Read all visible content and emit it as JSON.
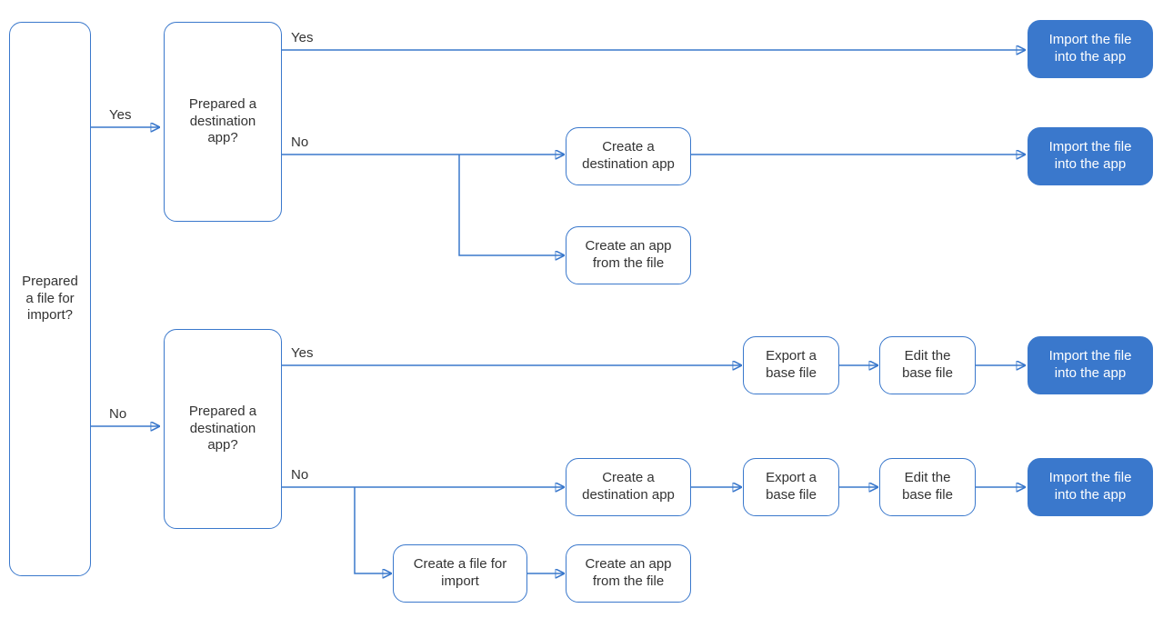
{
  "colors": {
    "stroke": "#3a78cc",
    "fill": "#3a78cc"
  },
  "labels": {
    "yes": "Yes",
    "no": "No"
  },
  "nodes": {
    "q_file": "Prepared a file for import?",
    "q_dest_top": "Prepared a destination app?",
    "q_dest_bot": "Prepared a destination app?",
    "create_dest_top": "Create a destination app",
    "create_from_file_top": "Create an app from the file",
    "import_1": "Import the file into the app",
    "import_2": "Import the file into the app",
    "export_base_1": "Export a base file",
    "edit_base_1": "Edit the base file",
    "import_3": "Import the file into the app",
    "create_dest_bot": "Create a destination app",
    "export_base_2": "Export a base file",
    "edit_base_2": "Edit the base file",
    "import_4": "Import the file into the app",
    "create_file": "Create a file for import",
    "create_from_file_bot": "Create an app from the file"
  }
}
